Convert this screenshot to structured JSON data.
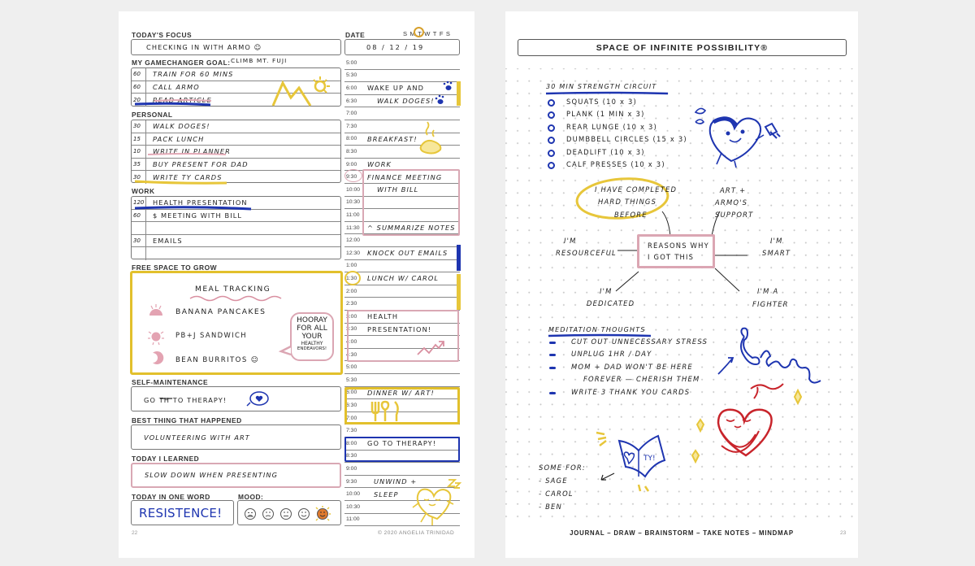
{
  "left_page": {
    "todays_focus": {
      "label": "TODAY'S FOCUS",
      "value": "CHECKING IN WITH ARMO ☺"
    },
    "date": {
      "label": "DATE",
      "value": "08 / 12 / 19",
      "weekdays": "SMTWTFS",
      "selected_day": "T"
    },
    "gamechanger": {
      "label": "MY GAMECHANGER GOAL:",
      "value": "CLIMB MT. FUJI",
      "rows": [
        {
          "min": "60",
          "task": "TRAIN FOR 60 MINS"
        },
        {
          "min": "60",
          "task": "CALL ARMO"
        },
        {
          "min": "20",
          "task": "READ ARTICLE"
        }
      ]
    },
    "personal": {
      "label": "PERSONAL",
      "rows": [
        {
          "min": "30",
          "task": "WALK DOGES!"
        },
        {
          "min": "15",
          "task": "PACK LUNCH"
        },
        {
          "min": "10",
          "task": "WRITE IN PLANNER"
        },
        {
          "min": "35",
          "task": "BUY PRESENT FOR DAD"
        },
        {
          "min": "30",
          "task": "WRITE TY CARDS"
        }
      ]
    },
    "work": {
      "label": "WORK",
      "rows": [
        {
          "min": "120",
          "task": "HEALTH PRESENTATION"
        },
        {
          "min": "60",
          "task": "$ MEETING WITH BILL"
        },
        {
          "min": "",
          "task": ""
        },
        {
          "min": "30",
          "task": "EMAILS"
        },
        {
          "min": "",
          "task": ""
        }
      ]
    },
    "free_space": {
      "label": "FREE SPACE TO GROW",
      "title": "MEAL TRACKING",
      "meals": [
        "BANANA PANCAKES",
        "PB+J SANDWICH",
        "BEAN BURRITOS ☺"
      ],
      "bubble": [
        "HOORAY",
        "FOR ALL",
        "YOUR",
        "HEALTHY",
        "ENDEAVORS!"
      ]
    },
    "self_maintenance": {
      "label": "SELF-MAINTENANCE",
      "value": "GO TH TO THERAPY!"
    },
    "best_thing": {
      "label": "BEST THING THAT HAPPENED",
      "value": "VOLUNTEERING WITH ART"
    },
    "learned": {
      "label": "TODAY I LEARNED",
      "value": "SLOW DOWN WHEN PRESENTING"
    },
    "one_word": {
      "label": "TODAY IN ONE WORD",
      "value": "RESISTENCE!"
    },
    "mood": {
      "label": "MOOD:",
      "options": [
        "very-sad",
        "sad",
        "neutral",
        "happy",
        "very-happy"
      ],
      "selected": "very-happy"
    },
    "page_number": "22",
    "copyright": "© 2020 ANGELIA TRINIDAD",
    "schedule": [
      {
        "time": "5:00",
        "event": ""
      },
      {
        "time": "5:30",
        "event": ""
      },
      {
        "time": "6:00",
        "event": "WAKE UP AND"
      },
      {
        "time": "6:30",
        "event": "WALK DOGES!"
      },
      {
        "time": "7:00",
        "event": ""
      },
      {
        "time": "7:30",
        "event": ""
      },
      {
        "time": "8:00",
        "event": "BREAKFAST!"
      },
      {
        "time": "8:30",
        "event": ""
      },
      {
        "time": "9:00",
        "event": "WORK"
      },
      {
        "time": "9:30",
        "event": "FINANCE MEETING"
      },
      {
        "time": "10:00",
        "event": "WITH BILL"
      },
      {
        "time": "10:30",
        "event": ""
      },
      {
        "time": "11:00",
        "event": ""
      },
      {
        "time": "11:30",
        "event": "^ SUMMARIZE NOTES"
      },
      {
        "time": "12:00",
        "event": ""
      },
      {
        "time": "12:30",
        "event": "KNOCK OUT EMAILS"
      },
      {
        "time": "1:00",
        "event": ""
      },
      {
        "time": "1:30",
        "event": "LUNCH W/ CAROL"
      },
      {
        "time": "2:00",
        "event": ""
      },
      {
        "time": "2:30",
        "event": ""
      },
      {
        "time": "3:00",
        "event": "HEALTH"
      },
      {
        "time": "3:30",
        "event": "PRESENTATION!"
      },
      {
        "time": "4:00",
        "event": ""
      },
      {
        "time": "4:30",
        "event": ""
      },
      {
        "time": "5:00",
        "event": ""
      },
      {
        "time": "5:30",
        "event": ""
      },
      {
        "time": "6:00",
        "event": "DINNER W/ ART!"
      },
      {
        "time": "6:30",
        "event": ""
      },
      {
        "time": "7:00",
        "event": ""
      },
      {
        "time": "7:30",
        "event": ""
      },
      {
        "time": "8:00",
        "event": "GO TO THERAPY!"
      },
      {
        "time": "8:30",
        "event": ""
      },
      {
        "time": "9:00",
        "event": ""
      },
      {
        "time": "9:30",
        "event": "UNWIND +"
      },
      {
        "time": "10:00",
        "event": "SLEEP"
      },
      {
        "time": "10:30",
        "event": ""
      },
      {
        "time": "11:00",
        "event": ""
      }
    ]
  },
  "right_page": {
    "title": "SPACE OF INFINITE POSSIBILITY®",
    "circuit": {
      "heading": "30 MIN STRENGTH CIRCUIT",
      "items": [
        "SQUATS (10 x 3)",
        "PLANK (1 MIN x 3)",
        "REAR LUNGE (10 x 3)",
        "DUMBBELL CIRCLES (15 x 3)",
        "DEADLIFT (10 x 3)",
        "CALF PRESSES (10 x 3)"
      ]
    },
    "mindmap": {
      "center": [
        "REASONS WHY",
        "I GOT THIS"
      ],
      "nodes": {
        "completed": [
          "I HAVE COMPLETED",
          "HARD THINGS",
          "BEFORE"
        ],
        "support": [
          "ART +",
          "ARMO'S",
          "SUPPORT"
        ],
        "resourceful": [
          "I'M",
          "RESOURCEFUL"
        ],
        "smart": [
          "I'M",
          "SMART"
        ],
        "dedicated": [
          "I'M",
          "DEDICATED"
        ],
        "fighter": [
          "I'M A",
          "FIGHTER"
        ]
      }
    },
    "meditation": {
      "heading": "MEDITATION THOUGHTS",
      "items": [
        "CUT OUT UNNECESSARY STRESS",
        "UNPLUG 1HR / DAY",
        "MOM + DAD WON'T BE HERE",
        "WRITE 3 THANK YOU CARDS"
      ],
      "continuation": "FOREVER — CHERISH THEM"
    },
    "some_for": {
      "heading": "SOME FOR:",
      "names": [
        "- SAGE",
        "- CAROL",
        "- BEN"
      ]
    },
    "card_text": "TY!",
    "footer": "JOURNAL – DRAW – BRAINSTORM – TAKE NOTES – MINDMAP",
    "page_number": "23"
  }
}
